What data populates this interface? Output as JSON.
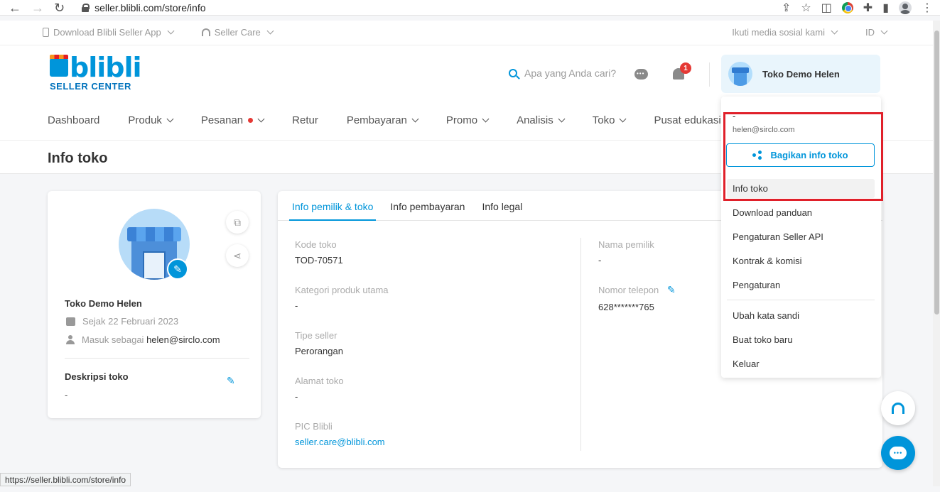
{
  "browser": {
    "url": "seller.blibli.com/store/info"
  },
  "util_bar": {
    "download_app": "Download Blibli Seller App",
    "seller_care": "Seller Care",
    "social": "Ikuti media sosial kami",
    "language": "ID"
  },
  "header": {
    "logo_text": "blibli",
    "logo_sub": "SELLER CENTER",
    "search_placeholder": "Apa yang Anda cari?",
    "notification_count": "1",
    "store_name": "Toko Demo Helen"
  },
  "nav": {
    "items": [
      "Dashboard",
      "Produk",
      "Pesanan",
      "Retur",
      "Pembayaran",
      "Promo",
      "Analisis",
      "Toko",
      "Pusat edukasi"
    ]
  },
  "page": {
    "title": "Info toko"
  },
  "store_card": {
    "name": "Toko Demo Helen",
    "since": "Sejak 22 Februari 2023",
    "login_prefix": "Masuk sebagai",
    "login_email": "helen@sirclo.com",
    "desc_label": "Deskripsi toko",
    "desc_value": "-"
  },
  "tabs": [
    "Info pemilik & toko",
    "Info pembayaran",
    "Info legal"
  ],
  "info_fields": {
    "kode_toko": {
      "label": "Kode toko",
      "value": "TOD-70571"
    },
    "kategori": {
      "label": "Kategori produk utama",
      "value": "-"
    },
    "tipe_seller": {
      "label": "Tipe seller",
      "value": "Perorangan"
    },
    "alamat": {
      "label": "Alamat toko",
      "value": "-"
    },
    "pic": {
      "label": "PIC Blibli",
      "value": "seller.care@blibli.com"
    },
    "nama_pemilik": {
      "label": "Nama pemilik",
      "value": "-"
    },
    "nomor_telepon": {
      "label": "Nomor telepon",
      "value": "628*******765"
    }
  },
  "dropdown": {
    "name": "-",
    "email": "helen@sirclo.com",
    "share_label": "Bagikan info toko",
    "items": [
      "Info toko",
      "Download panduan",
      "Pengaturan Seller API",
      "Kontrak & komisi",
      "Pengaturan",
      "Ubah kata sandi",
      "Buat toko baru",
      "Keluar"
    ]
  },
  "status_url": "https://seller.blibli.com/store/info",
  "colors": {
    "accent": "#0095da",
    "highlight": "#e0202a",
    "badge": "#e53935"
  }
}
